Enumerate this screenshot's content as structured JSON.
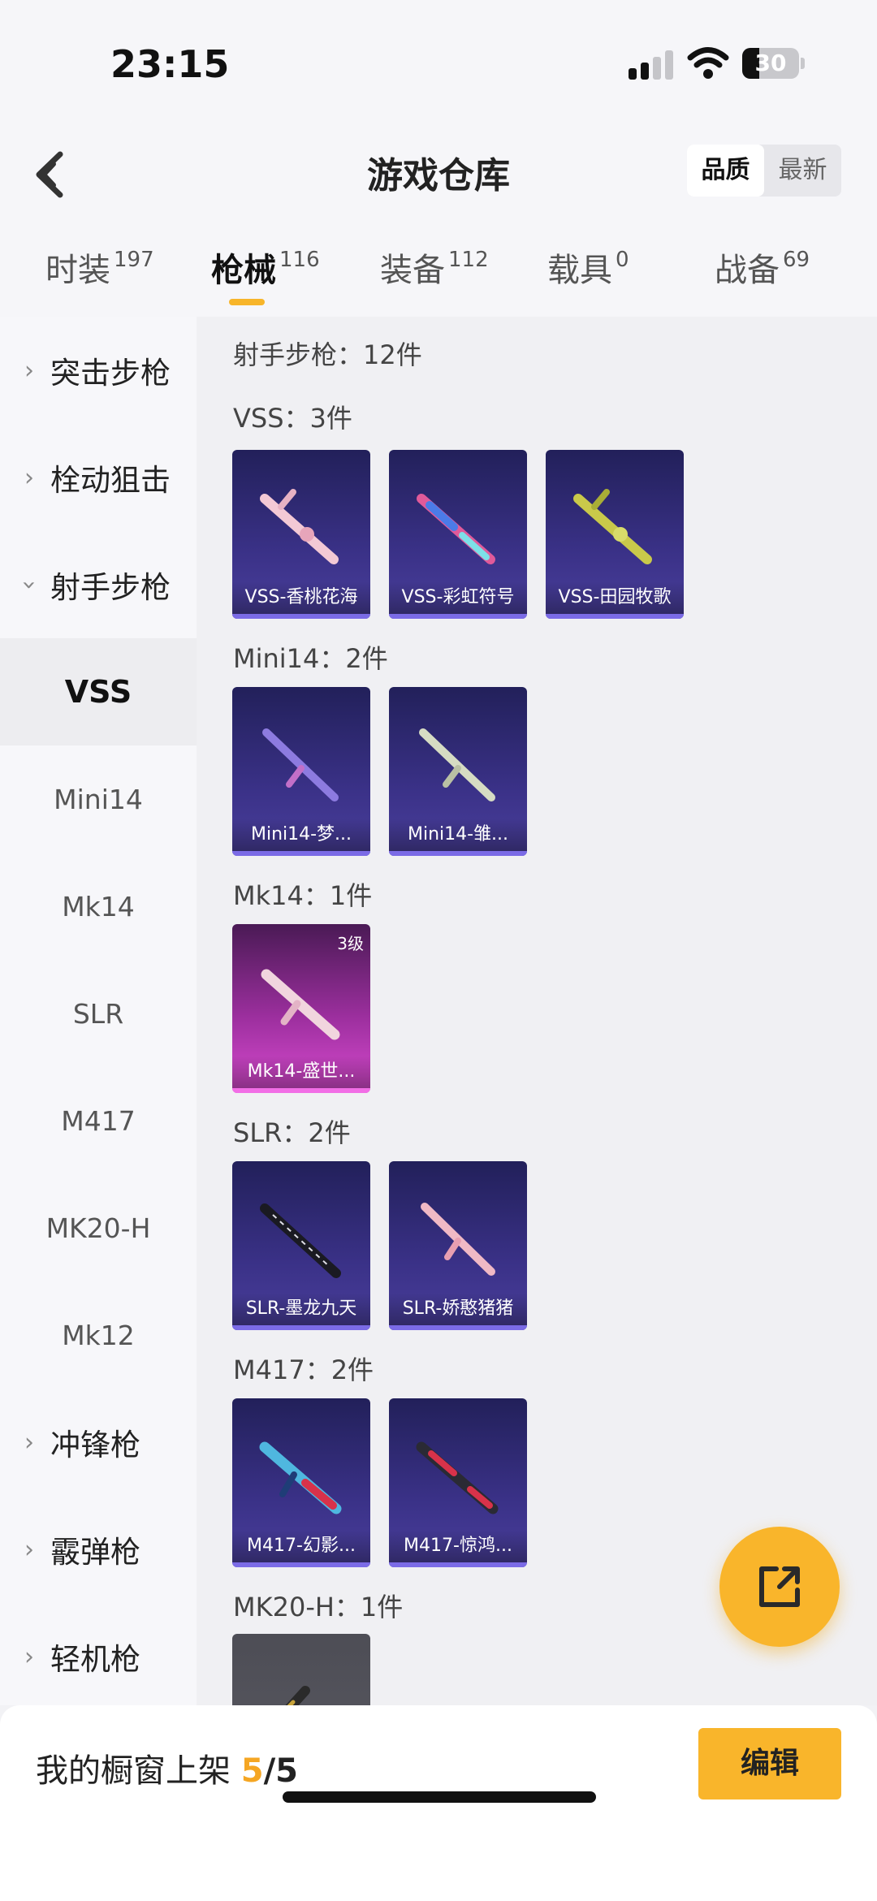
{
  "status_bar": {
    "time": "23:15",
    "battery": "30",
    "battery_level": 0.3
  },
  "header": {
    "title": "游戏仓库",
    "sort_options": [
      "品质",
      "最新"
    ],
    "sort_selected": "品质"
  },
  "tabs": [
    {
      "label": "时装",
      "count": "197"
    },
    {
      "label": "枪械",
      "count": "116",
      "active": true
    },
    {
      "label": "装备",
      "count": "112"
    },
    {
      "label": "载具",
      "count": "0"
    },
    {
      "label": "战备",
      "count": "69"
    }
  ],
  "sidebar": {
    "groups": [
      "突击步枪",
      "栓动狙击",
      "射手步枪",
      "冲锋枪",
      "霰弹枪",
      "轻机枪"
    ],
    "sub_items": [
      "VSS",
      "Mini14",
      "Mk14",
      "SLR",
      "M417",
      "MK20-H",
      "Mk12"
    ],
    "active_sub": "VSS"
  },
  "content": {
    "category_header": "射手步枪：12件",
    "sections": [
      {
        "label": "VSS：3件",
        "items": [
          "VSS-香桃花海",
          "VSS-彩虹符号",
          "VSS-田园牧歌"
        ]
      },
      {
        "label": "Mini14：2件",
        "items": [
          "Mini14-梦...",
          "Mini14-雏..."
        ]
      },
      {
        "label": "Mk14：1件",
        "items": [
          "Mk14-盛世..."
        ],
        "level": "3级"
      },
      {
        "label": "SLR：2件",
        "items": [
          "SLR-墨龙九天",
          "SLR-娇憨猪猪"
        ]
      },
      {
        "label": "M417：2件",
        "items": [
          "M417-幻影...",
          "M417-惊鸿..."
        ]
      },
      {
        "label": "MK20-H：1件",
        "items": []
      }
    ]
  },
  "bottom": {
    "shelf_label": "我的橱窗上架",
    "shelf_current": "5",
    "shelf_total": "/5",
    "edit_button": "编辑"
  },
  "colors": {
    "accent": "#f9b52b",
    "card_blue": "#3a3187",
    "card_pink": "#d94bd0"
  },
  "icons": {
    "back": "chevron-left-icon",
    "fab": "share-external-icon"
  }
}
